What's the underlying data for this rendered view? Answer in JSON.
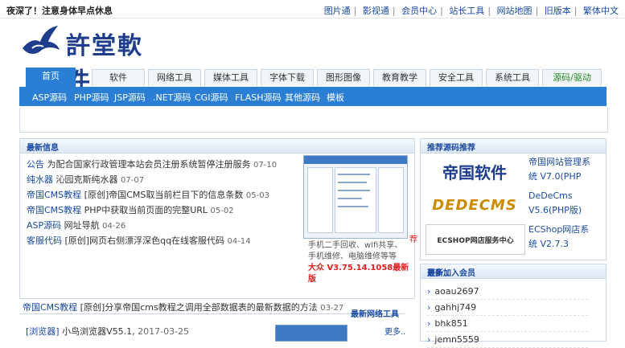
{
  "topbar": {
    "notice": "夜深了！注意身体早点休息",
    "links": [
      "图片通",
      "影视通",
      "会员中心",
      "站长工具",
      "网站地图",
      "旧版本",
      "繁体中文"
    ]
  },
  "logo": {
    "text": "許堂軟件"
  },
  "nav": {
    "tabs": [
      "首页",
      "软件",
      "网络工具",
      "媒体工具",
      "字体下载",
      "图形图像",
      "教育教学",
      "安全工具",
      "系统工具",
      "源码/驱动"
    ]
  },
  "subnav": {
    "items": [
      "ASP源码",
      "PHP源码",
      "JSP源码",
      ".NET源码",
      "CGI源码",
      "FLASH源码",
      "其他源码",
      "模板"
    ]
  },
  "news": {
    "title": "最新信息",
    "rows": [
      {
        "cat": "公告",
        "text": "为配合国家行政管理本站会员注册系统暂停注册服务",
        "date": "07-10"
      },
      {
        "cat": "纯水器",
        "text": "沁园克斯纯水器",
        "date": "07-07"
      },
      {
        "cat": "帝国CMS教程",
        "text": "[原创]帝国CMS取当前栏目下的信息条数",
        "date": "05-03"
      },
      {
        "cat": "帝国CMS教程",
        "text": "PHP中获取当前页面的完整URL",
        "date": "05-02"
      },
      {
        "cat": "ASP源码",
        "text": "网址导航",
        "date": "04-26"
      },
      {
        "cat": "客服代码",
        "text": "[原创]网页右侧漂浮深色qq在线客服代码",
        "date": "04-14"
      }
    ],
    "screenshot_caption": "手机二手回收、wifi共享、手机维修、电脑维修等等",
    "screenshot_link": "大众 V3.75.14.1058最新版",
    "flag": "荐"
  },
  "sponsor": {
    "title": "推荐源码推荐",
    "items": [
      {
        "logo": "帝国软件",
        "text": "帝国网站管理系统 V7.0(PHP"
      },
      {
        "logo": "DEDECMS",
        "text": "DeDeCms V5.6(PHP版)"
      },
      {
        "logo": "ECSHOP网店服务中心",
        "text": "ECShop网店系统 V2.7.3"
      }
    ]
  },
  "members": {
    "title": "最新加入会员",
    "more": "更多..",
    "list": [
      "aoau2697",
      "gahhj749",
      "bhk851",
      "jemn5559"
    ]
  },
  "bottom": {
    "row": {
      "cat": "帝国CMS教程",
      "text": "[原创]分享帝国cms教程之调用全部数据表的最新数据的方法",
      "date": "03-27"
    },
    "tools_title": "最新网络工具",
    "tools_more": "更多..",
    "last": {
      "cat": "[浏览器]",
      "text": "小鸟浏览器V55.1",
      "date": "2017-03-25"
    }
  },
  "colors": {
    "accent": "#2a7fd4",
    "link": "#1a4aa0",
    "alert": "#e02020"
  }
}
